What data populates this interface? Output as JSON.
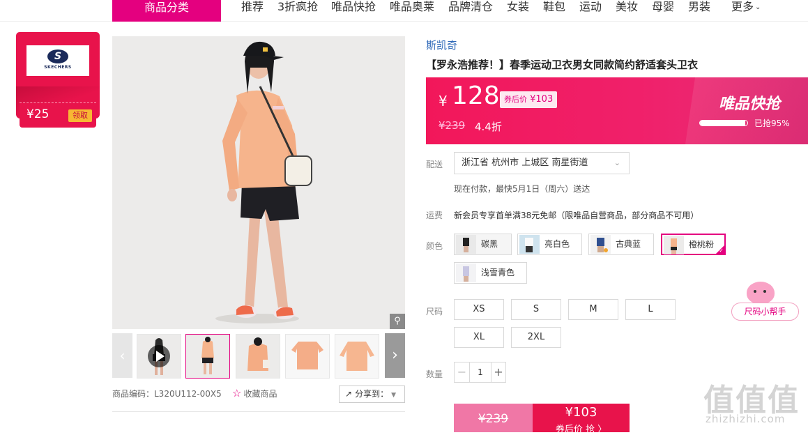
{
  "nav": {
    "category_label": "商品分类",
    "items": [
      "推荐",
      "3折疯抢",
      "唯品快抢",
      "唯品奥莱",
      "品牌清仓",
      "女装",
      "鞋包",
      "运动",
      "美妆",
      "母婴",
      "男装",
      "更多"
    ]
  },
  "coupon": {
    "brand_logo_letter": "S",
    "brand_logo_text": "SKECHERS",
    "amount": "¥25",
    "claim_label": "领取"
  },
  "gallery": {
    "zoom_icon": "magnifier-icon",
    "prev_icon": "chevron-left-icon",
    "next_icon": "chevron-right-icon",
    "play_icon": "play-icon"
  },
  "sku_code": "商品编码：L320U112-00X5",
  "favorite_label": "收藏商品",
  "share_label": "分享到：",
  "product": {
    "brand": "斯凯奇",
    "title": "【罗永浩推荐！】春季运动卫衣男女同款简约舒适套头卫衣"
  },
  "price": {
    "currency": "¥",
    "current": "128",
    "coupon_label": "券后价",
    "coupon_price": "¥103",
    "original": "¥239",
    "discount": "4.4折",
    "flash_title": "唯品快抢",
    "sold_progress": 0.95,
    "sold_text": "已抢95%"
  },
  "delivery": {
    "label": "配送",
    "address": "浙江省 杭州市 上城区 南星街道",
    "note": "现在付款，最快5月1日（周六）送达"
  },
  "freight": {
    "label": "运费",
    "text": "新会员专享首单满38元免邮（限唯品自营商品，部分商品不可用）"
  },
  "colors": {
    "label": "颜色",
    "options": [
      "碳黑",
      "亮白色",
      "古典蓝",
      "橙桃粉",
      "浅雪青色"
    ],
    "selected": "橙桃粉"
  },
  "sizes": {
    "label": "尺码",
    "options": [
      "XS",
      "S",
      "M",
      "L",
      "XL",
      "2XL"
    ]
  },
  "quantity": {
    "label": "数量",
    "value": "1",
    "minus": "−",
    "plus": "+"
  },
  "buy": {
    "original": "¥239",
    "coupon_price": "¥103",
    "coupon_text": "券后价 抢 〉"
  },
  "helper_label": "尺码小帮手",
  "watermark": {
    "chars": "值值值",
    "text": "zhizhizhi.com"
  }
}
